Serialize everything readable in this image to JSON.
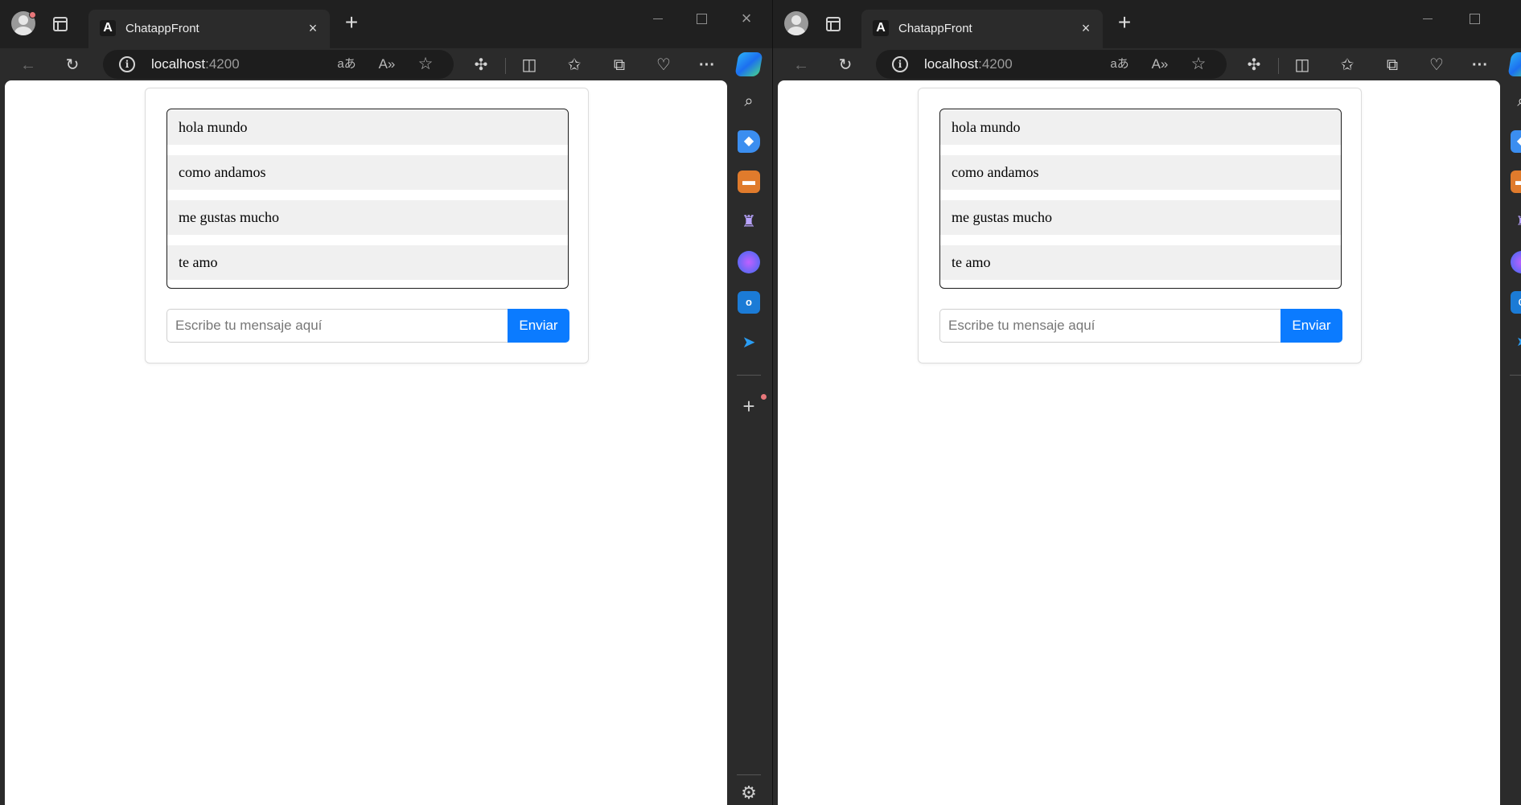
{
  "windows": [
    {
      "tab": {
        "title": "ChatappFront",
        "favicon": "A"
      },
      "address": {
        "host": "localhost",
        "port": ":4200"
      },
      "chat": {
        "messages": [
          "hola mundo",
          "como andamos",
          "me gustas mucho",
          "te amo"
        ],
        "input": {
          "placeholder": "Escribe tu mensaje aquí",
          "value": ""
        },
        "send_label": "Enviar"
      }
    },
    {
      "tab": {
        "title": "ChatappFront",
        "favicon": "A"
      },
      "address": {
        "host": "localhost",
        "port": ":4200"
      },
      "chat": {
        "messages": [
          "hola mundo",
          "como andamos",
          "me gustas mucho",
          "te amo"
        ],
        "input": {
          "placeholder": "Escribe tu mensaje aquí",
          "value": ""
        },
        "send_label": "Enviar"
      }
    }
  ],
  "icons": {
    "close": "×",
    "new_tab": "+",
    "back": "←",
    "reload": "↻",
    "translate": "aあ",
    "read_aloud": "A»",
    "favorite": "☆",
    "more": "···"
  },
  "colors": {
    "send_button": "#0b7bff",
    "message_bg": "#f0f0f0"
  }
}
